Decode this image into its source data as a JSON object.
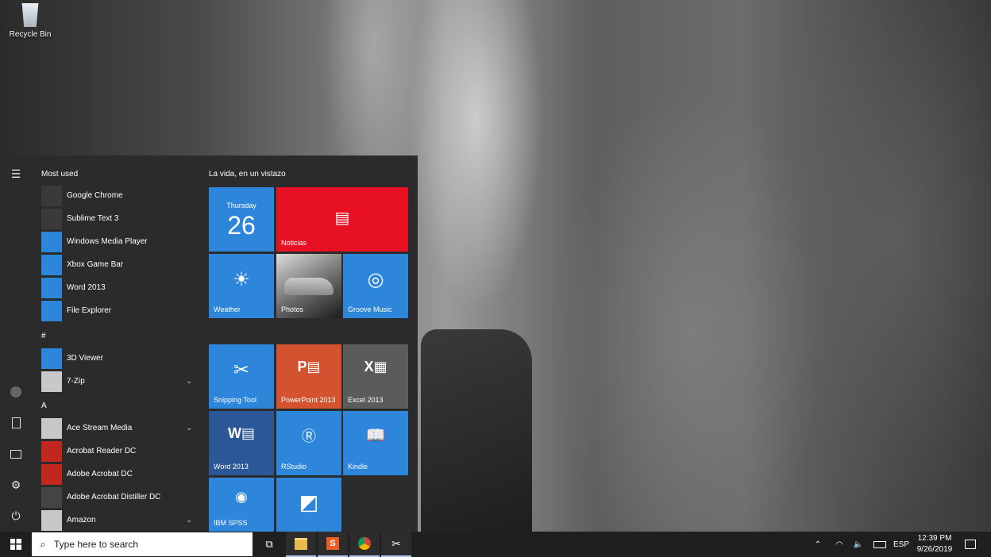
{
  "desktop": {
    "recycle_bin_label": "Recycle Bin"
  },
  "start_menu": {
    "most_used_header": "Most used",
    "most_used": [
      {
        "label": "Google Chrome",
        "icon": "chrome-icon",
        "color": "#3a3a3a"
      },
      {
        "label": "Sublime Text 3",
        "icon": "sublime-icon",
        "color": "#3a3a3a"
      },
      {
        "label": "Windows Media Player",
        "icon": "media-player-icon",
        "color": "#2d86d9"
      },
      {
        "label": "Xbox Game Bar",
        "icon": "xbox-icon",
        "color": "#2d86d9"
      },
      {
        "label": "Word 2013",
        "icon": "word-icon",
        "color": "#2d86d9"
      },
      {
        "label": "File Explorer",
        "icon": "folder-icon",
        "color": "#2d86d9"
      }
    ],
    "hash_header": "#",
    "hash_apps": [
      {
        "label": "3D Viewer",
        "icon": "cube-icon",
        "color": "#2d86d9"
      },
      {
        "label": "7-Zip",
        "icon": "folder-icon",
        "color": "#c8c8c8",
        "expandable": true
      }
    ],
    "a_header": "A",
    "a_apps": [
      {
        "label": "Ace Stream Media",
        "icon": "folder-icon",
        "color": "#c8c8c8",
        "expandable": true
      },
      {
        "label": "Acrobat Reader DC",
        "icon": "acrobat-icon",
        "color": "#c1271c"
      },
      {
        "label": "Adobe Acrobat DC",
        "icon": "acrobat-icon",
        "color": "#c1271c"
      },
      {
        "label": "Adobe Acrobat Distiller DC",
        "icon": "distiller-icon",
        "color": "#444444"
      },
      {
        "label": "Amazon",
        "icon": "folder-icon",
        "color": "#c8c8c8",
        "expandable": true
      }
    ],
    "tiles_header": "La vida, en un vistazo",
    "tiles": {
      "calendar": {
        "day": "Thursday",
        "date": "26"
      },
      "news": "Noticias",
      "weather": "Weather",
      "photos": "Photos",
      "groove": "Groove Music",
      "snipping": "Snipping Tool",
      "powerpoint": "PowerPoint 2013",
      "excel": "Excel 2013",
      "word": "Word 2013",
      "rstudio": "RStudio",
      "kindle": "Kindle",
      "spss": "IBM SPSS"
    }
  },
  "taskbar": {
    "search_placeholder": "Type here to search",
    "language": "ESP",
    "time": "12:39 PM",
    "date": "9/26/2019"
  },
  "colors": {
    "tile_blue": "#2d86d9",
    "news_red": "#e81123",
    "ppt_orange": "#d35230",
    "excel_gray": "#5b5b5b"
  }
}
